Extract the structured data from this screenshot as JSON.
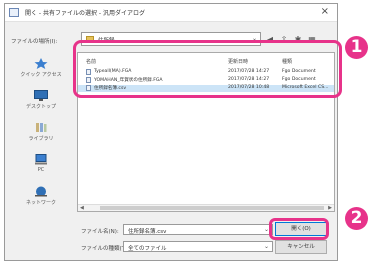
{
  "window": {
    "title": "開く - 共有ファイルの選択 - 汎用ダイアログ",
    "close_glyph": "×"
  },
  "location": {
    "label": "ファイルの場所(I):",
    "value": "住所録",
    "caret": "⌄"
  },
  "toolbar": {
    "icons": [
      "back-icon",
      "up-folder-icon",
      "new-folder-icon",
      "view-menu-icon"
    ],
    "glyphs": [
      "◀",
      "⇧",
      "✱",
      "▦"
    ]
  },
  "sidebar": {
    "items": [
      {
        "label": "クイック アクセス",
        "icon": "star-icon"
      },
      {
        "label": "デスクトップ",
        "icon": "desktop-icon"
      },
      {
        "label": "ライブラリ",
        "icon": "library-icon"
      },
      {
        "label": "PC",
        "icon": "pc-icon"
      },
      {
        "label": "ネットワーク",
        "icon": "network-icon"
      }
    ]
  },
  "file_list": {
    "columns": [
      "名前",
      "更新日時",
      "種類"
    ],
    "rows": [
      {
        "name": "Typeall(MA).FGA",
        "date": "2017/07/28 14:27",
        "type": "Fgo Document"
      },
      {
        "name": "YOMAHAN_年賀状の住所録.FGA",
        "date": "2017/07/28 14:27",
        "type": "Fgo Document"
      },
      {
        "name": "住所録名簿.csv",
        "date": "2017/07/28 10:48",
        "type": "Microsoft Excel CS..."
      }
    ]
  },
  "filename": {
    "label": "ファイル名(N):",
    "value": "住所録名簿.csv",
    "caret": "⌄"
  },
  "filetype": {
    "label": "ファイルの種類(T):",
    "value": "全てのファイル",
    "caret": "⌄"
  },
  "buttons": {
    "open": "開く(O)",
    "cancel": "キャンセル"
  },
  "annotations": {
    "badge1": "1",
    "badge2": "2",
    "accent_color": "#e7338a"
  }
}
